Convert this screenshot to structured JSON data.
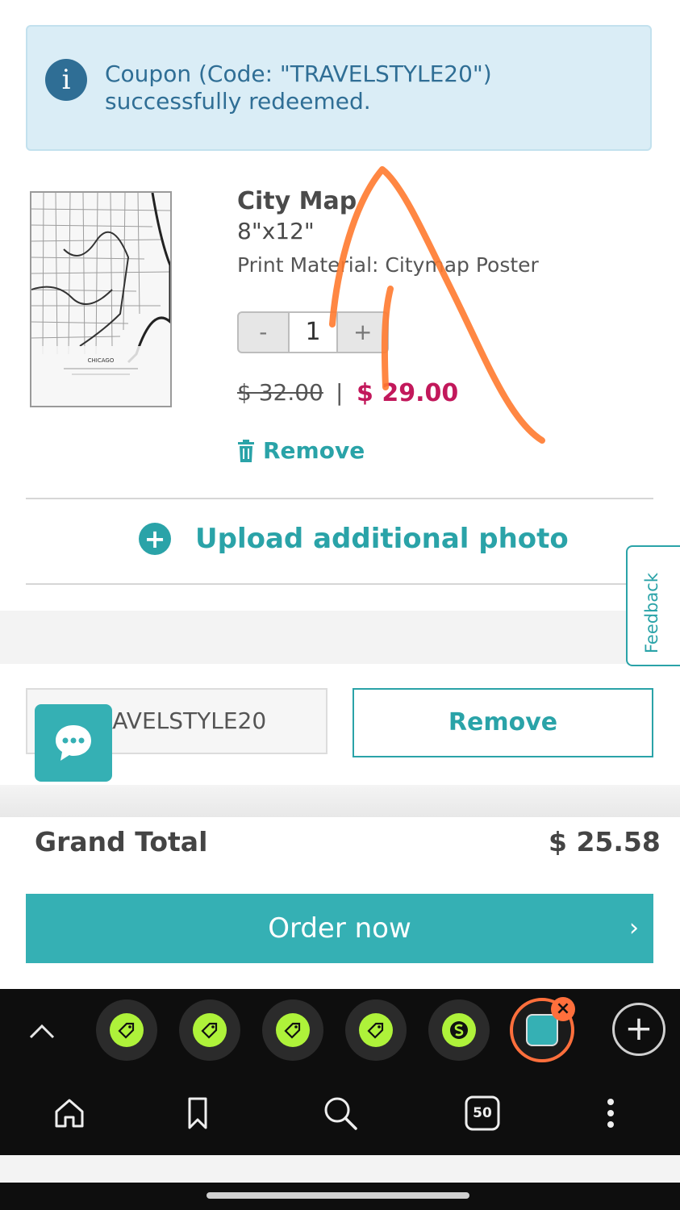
{
  "alert": {
    "icon": "info-icon",
    "text": "Coupon (Code: \"TRAVELSTYLE20\") successfully redeemed."
  },
  "product": {
    "image_caption": "CHICAGO",
    "title": "City Map",
    "size": "8\"x12\"",
    "material": "Print Material: Citymap Poster",
    "quantity": "1",
    "decrement_label": "-",
    "increment_label": "+",
    "old_price": "$ 32.00",
    "price_separator": "|",
    "new_price": "$ 29.00",
    "remove_label": "Remove"
  },
  "upload": {
    "label": "Upload additional photo"
  },
  "coupon": {
    "input_value": "TRAVELSTYLE20",
    "remove_label": "Remove"
  },
  "feedback": {
    "label": "Feedback"
  },
  "summary": {
    "grand_total_label": "Grand Total",
    "grand_total_value": "$ 25.58"
  },
  "order": {
    "label": "Order now",
    "chevron": "›"
  },
  "browser": {
    "tabs": [
      "grocery-tab-icon",
      "grocery-tab-icon",
      "grocery-tab-icon",
      "grocery-tab-icon",
      "s-tab-icon",
      "active-tab-icon"
    ],
    "tab_count": "50",
    "new_tab": "+"
  },
  "colors": {
    "accent": "#2aa3a8",
    "order_button": "#35b0b4",
    "sale_price": "#c2185b",
    "alert_bg": "#daedf6",
    "annotation": "#ff7a2f"
  }
}
